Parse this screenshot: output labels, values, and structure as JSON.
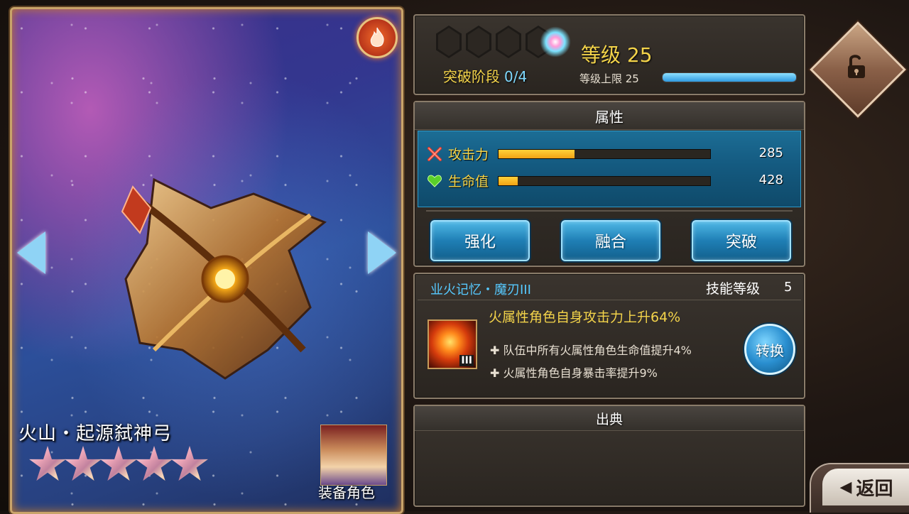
{
  "card": {
    "element_icon": "fire-icon",
    "weapon_name": "火山・起源弑神弓",
    "stars": 5,
    "equip_label": "装备角色"
  },
  "progress": {
    "breakthrough_label": "突破阶段",
    "breakthrough_value": "0/4",
    "level_label": "等级 25",
    "level_cap_label": "等级上限 25",
    "level_fraction": 1.0
  },
  "attributes": {
    "header": "属性",
    "items": [
      {
        "label": "攻击力",
        "value": "285",
        "fraction": 0.36,
        "icon": "crossed-swords-icon"
      },
      {
        "label": "生命值",
        "value": "428",
        "fraction": 0.09,
        "icon": "heart-icon"
      }
    ],
    "buttons": [
      "强化",
      "融合",
      "突破"
    ]
  },
  "skill": {
    "name": "业火记忆・魔刃III",
    "level_label": "技能等级",
    "level_value": "5",
    "icon_numeral": "III",
    "main_effect": "火属性角色自身攻击力上升64%",
    "sub_effects": [
      "✚ 队伍中所有火属性角色生命值提升4%",
      "✚ 火属性角色自身暴击率提升9%"
    ],
    "convert_label": "转换"
  },
  "source": {
    "header": "出典"
  },
  "nav": {
    "back_label": "返回"
  },
  "colors": {
    "gold": "#f4d44a",
    "cyan": "#56c9ff",
    "button_blue": "#1f7fb5"
  }
}
